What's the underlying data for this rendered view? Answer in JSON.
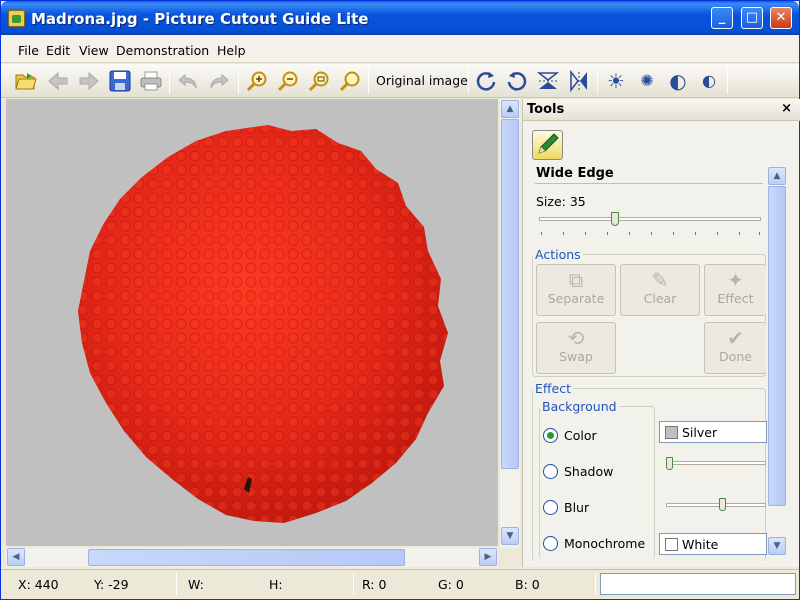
{
  "window": {
    "title": "Madrona.jpg - Picture Cutout Guide Lite",
    "minimize": "_",
    "maximize": "□",
    "close": "✕"
  },
  "menu": [
    "File",
    "Edit",
    "View",
    "Demonstration",
    "Help"
  ],
  "toolbar": {
    "original_image_label": "Original image",
    "icons": [
      "open-icon",
      "back-icon",
      "forward-icon",
      "save-icon",
      "print-icon",
      "undo-icon",
      "redo-icon",
      "zoom-in-icon",
      "zoom-out-icon",
      "zoom-fit-icon",
      "zoom-actual-icon",
      "rotate-cw-icon",
      "rotate-ccw-icon",
      "flip-vertical-icon",
      "flip-horizontal-icon",
      "brightness-up-icon",
      "brightness-down-icon",
      "contrast-up-icon",
      "contrast-down-icon"
    ]
  },
  "colors": {
    "canvas_bg": "#c0c0c0",
    "berry": "#e8281a",
    "accent": "#2255bb"
  },
  "tools": {
    "title": "Tools",
    "close": "×",
    "tool_name": "Wide Edge",
    "size_label": "Size: 35",
    "size_value": 35,
    "actions_legend": "Actions",
    "actions": {
      "separate": "Separate",
      "clear": "Clear",
      "effect": "Effect",
      "swap": "Swap",
      "done": "Done"
    },
    "effect_legend": "Effect",
    "background_legend": "Background",
    "background_options": {
      "color": "Color",
      "shadow": "Shadow",
      "blur": "Blur",
      "monochrome": "Monochrome"
    },
    "selected_option": "Color",
    "color_value": "Silver",
    "monochrome_value": "White"
  },
  "status": {
    "x": "X: 440",
    "y": "Y: -29",
    "w": "W:",
    "h": "H:",
    "r": "R: 0",
    "g": "G: 0",
    "b": "B: 0"
  }
}
